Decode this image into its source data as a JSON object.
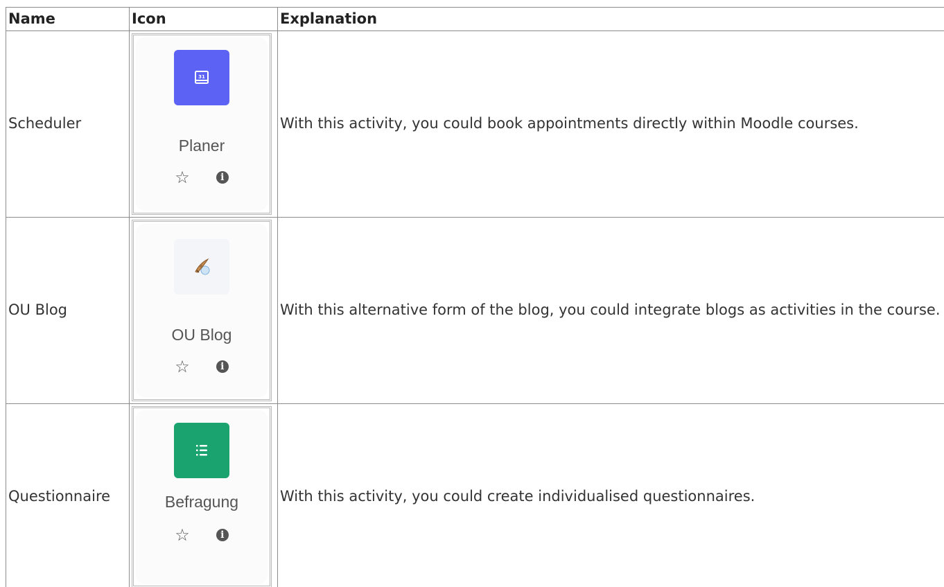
{
  "table": {
    "headers": {
      "name": "Name",
      "icon": "Icon",
      "explanation": "Explanation"
    },
    "rows": [
      {
        "name": "Scheduler",
        "card_label": "Planer",
        "icon": "calendar-icon",
        "tile_color": "#5b62f4",
        "explanation": "With this activity, you could book appointments directly within Moodle courses."
      },
      {
        "name": "OU Blog",
        "card_label": "OU Blog",
        "icon": "quill-inkpot-icon",
        "tile_color": "#f3f5f8",
        "explanation": "With this alternative form of the blog, you could integrate blogs as activities in the course."
      },
      {
        "name": "Questionnaire",
        "card_label": "Befragung",
        "icon": "checklist-icon",
        "tile_color": "#1ba36f",
        "explanation": "With this activity, you could create individualised questionnaires."
      }
    ]
  },
  "card_actions": {
    "favourite_icon": "star-outline-icon",
    "info_icon": "info-icon"
  }
}
